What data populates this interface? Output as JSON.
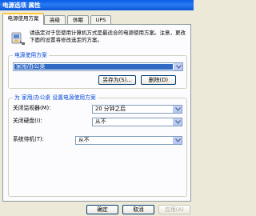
{
  "window": {
    "title": "电源选项 属性"
  },
  "tabs": [
    {
      "label": "电源使用方案"
    },
    {
      "label": "高级"
    },
    {
      "label": "休眠"
    },
    {
      "label": "UPS"
    }
  ],
  "description": "请选定对于您使用计算机方式是最适合的电源使用方案。注意，更改下面的设置将修改选定的方案。",
  "scheme_group": {
    "title": "电源使用方案",
    "selected": "家用/办公桌",
    "save_as_label": "另存为(S)...",
    "delete_label": "删除(D)"
  },
  "settings_group": {
    "title": "为 家用/办公桌 设置电源使用方案",
    "rows": [
      {
        "label": "关闭监视器(M):",
        "value": "20 分钟之后"
      },
      {
        "label": "关闭硬盘(I):",
        "value": "从不"
      },
      {
        "label": "系统待机(T):",
        "value": "从不"
      }
    ]
  },
  "footer": {
    "ok_label": "确定",
    "cancel_label": "取消",
    "apply_label": "应用(A)"
  }
}
